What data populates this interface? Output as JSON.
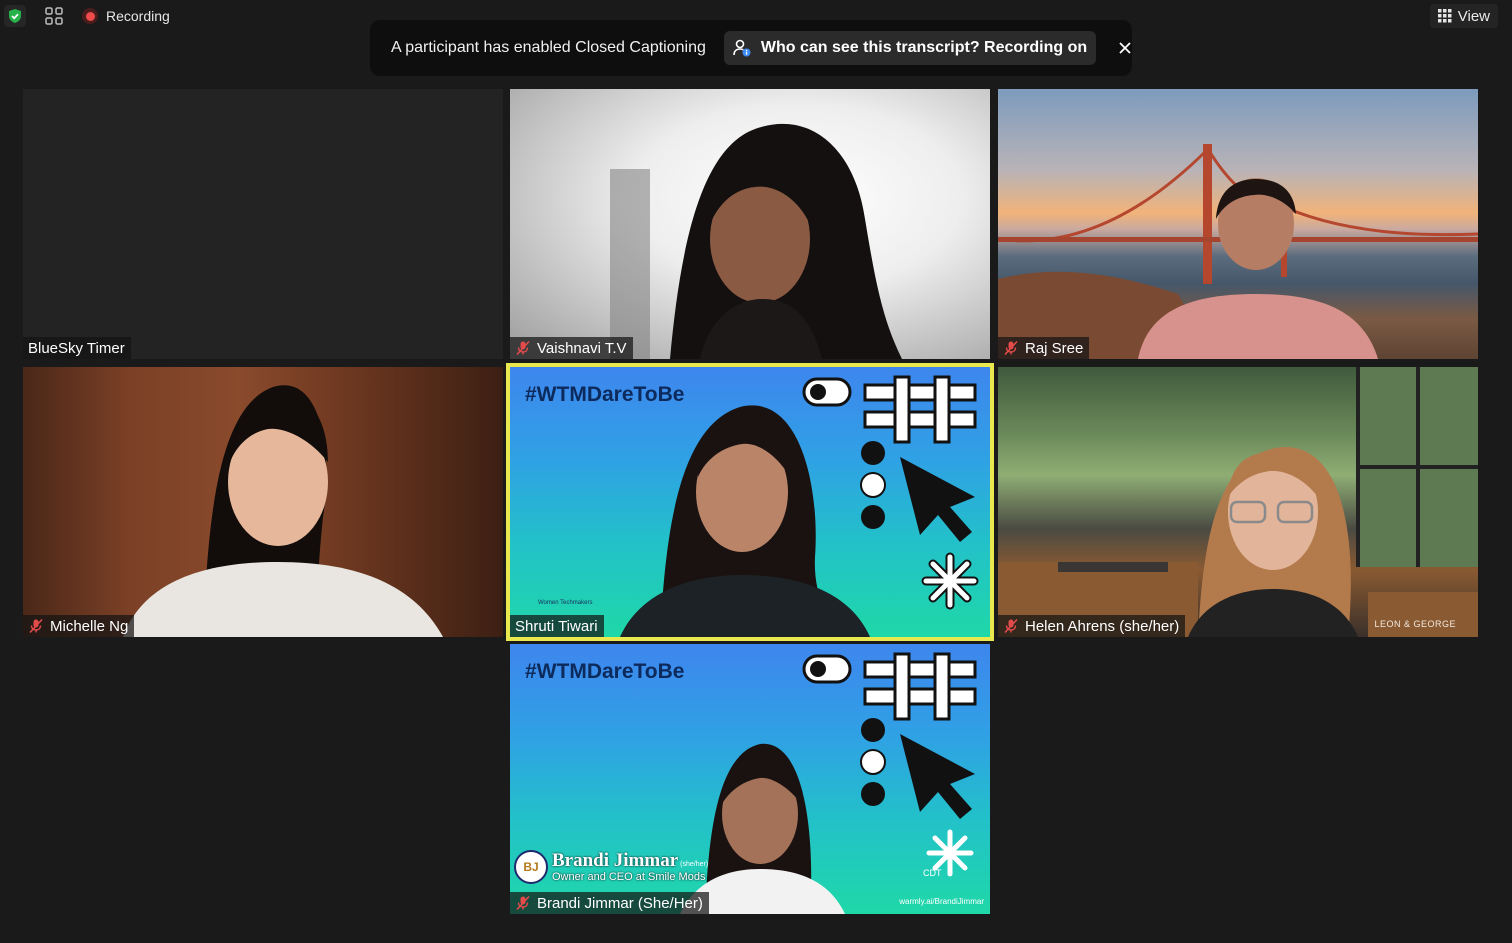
{
  "toolbar": {
    "recording_label": "Recording",
    "view_label": "View",
    "icons": {
      "security": "shield-check-icon",
      "apps": "grid-icon",
      "recording": "record-dot-icon",
      "view": "gallery-view-icon"
    }
  },
  "banner": {
    "message": "A participant has enabled Closed Captioning",
    "chip_label": "Who can see this transcript? Recording on",
    "chip_icon": "person-info-icon",
    "close_icon": "close-icon"
  },
  "participants": [
    {
      "name": "BlueSky Timer",
      "muted": false,
      "video": "off"
    },
    {
      "name": "Vaishnavi T.V",
      "muted": true,
      "video": "on"
    },
    {
      "name": "Raj Sree",
      "muted": true,
      "video": "on"
    },
    {
      "name": "Michelle Ng",
      "muted": true,
      "video": "on"
    },
    {
      "name": "Shruti Tiwari",
      "muted": false,
      "video": "on",
      "active_speaker": true
    },
    {
      "name": "Helen Ahrens (she/her)",
      "muted": true,
      "video": "on"
    },
    {
      "name": "Brandi Jimmar (She/Her)",
      "muted": true,
      "video": "on"
    }
  ],
  "backgrounds": {
    "hashtag": "#WTMDareToBe",
    "wtm_small": "Women Techmakers",
    "helen_watermark": "LEON & GEORGE",
    "brandi_lower_third_name": "Brandi Jimmar",
    "brandi_lower_third_pronoun": "(she/her)",
    "brandi_lower_third_title": "Owner and CEO at Smile Mods",
    "brandi_avatar_initials": "BJ",
    "brandi_link": "warmly.ai/BrandiJimmar",
    "brandi_tz": "CDT"
  },
  "colors": {
    "active_speaker_border": "#e9e84e",
    "muted_icon": "#e34b4b",
    "recording_dot": "#f04b4b",
    "shield": "#27b24a",
    "tile_bg": "#232323",
    "page_bg": "#1a1a1a"
  }
}
